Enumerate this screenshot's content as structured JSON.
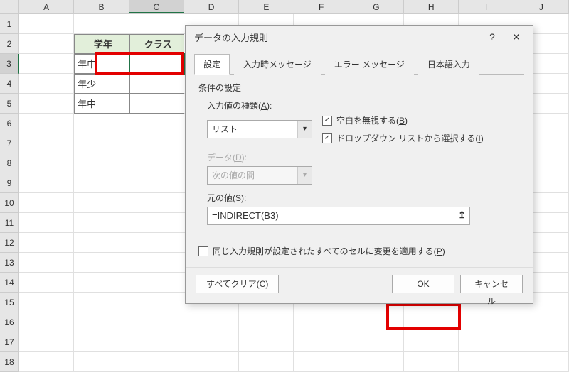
{
  "columns": [
    "A",
    "B",
    "C",
    "D",
    "E",
    "F",
    "G",
    "H",
    "I",
    "J"
  ],
  "rows": [
    "1",
    "2",
    "3",
    "4",
    "5",
    "6",
    "7",
    "8",
    "9",
    "10",
    "11",
    "12",
    "13",
    "14",
    "15",
    "16",
    "17",
    "18"
  ],
  "table": {
    "header_b": "学年",
    "header_c": "クラス",
    "b3": "年中",
    "b4": "年少",
    "b5": "年中"
  },
  "dialog": {
    "title": "データの入力規則",
    "help": "?",
    "close": "✕",
    "tabs": {
      "settings": "設定",
      "input_msg": "入力時メッセージ",
      "error_msg": "エラー メッセージ",
      "ime": "日本語入力"
    },
    "section": "条件の設定",
    "allow_label": "入力値の種類(",
    "allow_key": "A",
    "allow_label_end": "):",
    "allow_value": "リスト",
    "data_label": "データ(",
    "data_key": "D",
    "data_label_end": "):",
    "data_value": "次の値の間",
    "blank_label": "空白を無視する(",
    "blank_key": "B",
    "blank_label_end": ")",
    "dropdown_label": "ドロップダウン リストから選択する(",
    "dropdown_key": "I",
    "dropdown_label_end": ")",
    "source_label": "元の値(",
    "source_key": "S",
    "source_label_end": "):",
    "source_value": "=INDIRECT(B3)",
    "apply_label": "同じ入力規則が設定されたすべてのセルに変更を適用する(",
    "apply_key": "P",
    "apply_label_end": ")",
    "clear_btn": "すべてクリア(",
    "clear_key": "C",
    "clear_btn_end": ")",
    "ok": "OK",
    "cancel": "キャンセル"
  }
}
